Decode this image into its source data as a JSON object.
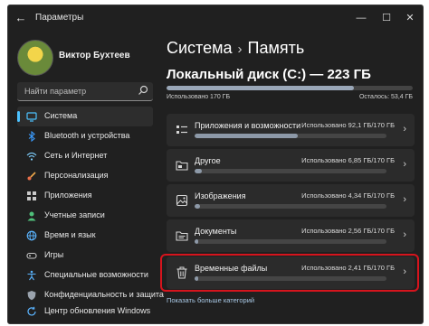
{
  "window": {
    "title": "Параметры",
    "back_glyph": "←",
    "minimize_glyph": "—",
    "maximize_glyph": "☐",
    "close_glyph": "✕"
  },
  "profile": {
    "name": "Виктор Бухтеев"
  },
  "search": {
    "placeholder": "Найти параметр"
  },
  "sidebar": {
    "items": [
      {
        "label": "Система",
        "icon": "monitor-icon",
        "active": true
      },
      {
        "label": "Bluetooth и устройства",
        "icon": "bluetooth-icon"
      },
      {
        "label": "Сеть и Интернет",
        "icon": "wifi-icon"
      },
      {
        "label": "Персонализация",
        "icon": "brush-icon"
      },
      {
        "label": "Приложения",
        "icon": "apps-icon"
      },
      {
        "label": "Учетные записи",
        "icon": "person-icon"
      },
      {
        "label": "Время и язык",
        "icon": "globe-icon"
      },
      {
        "label": "Игры",
        "icon": "gamepad-icon"
      },
      {
        "label": "Специальные возможности",
        "icon": "accessibility-icon"
      },
      {
        "label": "Конфиденциальность и защита",
        "icon": "shield-icon"
      },
      {
        "label": "Центр обновления Windows",
        "icon": "update-icon"
      }
    ]
  },
  "breadcrumb": {
    "parent": "Система",
    "separator": "›",
    "current": "Память"
  },
  "disk": {
    "title": "Локальный диск (C:) — 223 ГБ",
    "used_label": "Использовано 170 ГБ",
    "free_label": "Осталось: 53,4 ГБ",
    "used_fraction": 0.76
  },
  "categories": [
    {
      "name": "Приложения и возможности",
      "used": "Использовано 92,1 ГБ/170 ГБ",
      "fraction": 0.54,
      "icon": "apps-list-icon"
    },
    {
      "name": "Другое",
      "used": "Использовано 6,85 ГБ/170 ГБ",
      "fraction": 0.04,
      "icon": "folder-icon"
    },
    {
      "name": "Изображения",
      "used": "Использовано 4,34 ГБ/170 ГБ",
      "fraction": 0.03,
      "icon": "image-icon"
    },
    {
      "name": "Документы",
      "used": "Использовано 2,56 ГБ/170 ГБ",
      "fraction": 0.02,
      "icon": "document-folder-icon"
    },
    {
      "name": "Временные файлы",
      "used": "Использовано 2,41 ГБ/170 ГБ",
      "fraction": 0.014,
      "icon": "trash-icon",
      "highlighted": true
    }
  ],
  "more_link": "Показать больше категорий",
  "colors": {
    "accent": "#4cc2ff",
    "highlight_border": "#d6141d",
    "background": "#202020",
    "card": "#2b2b2b"
  }
}
